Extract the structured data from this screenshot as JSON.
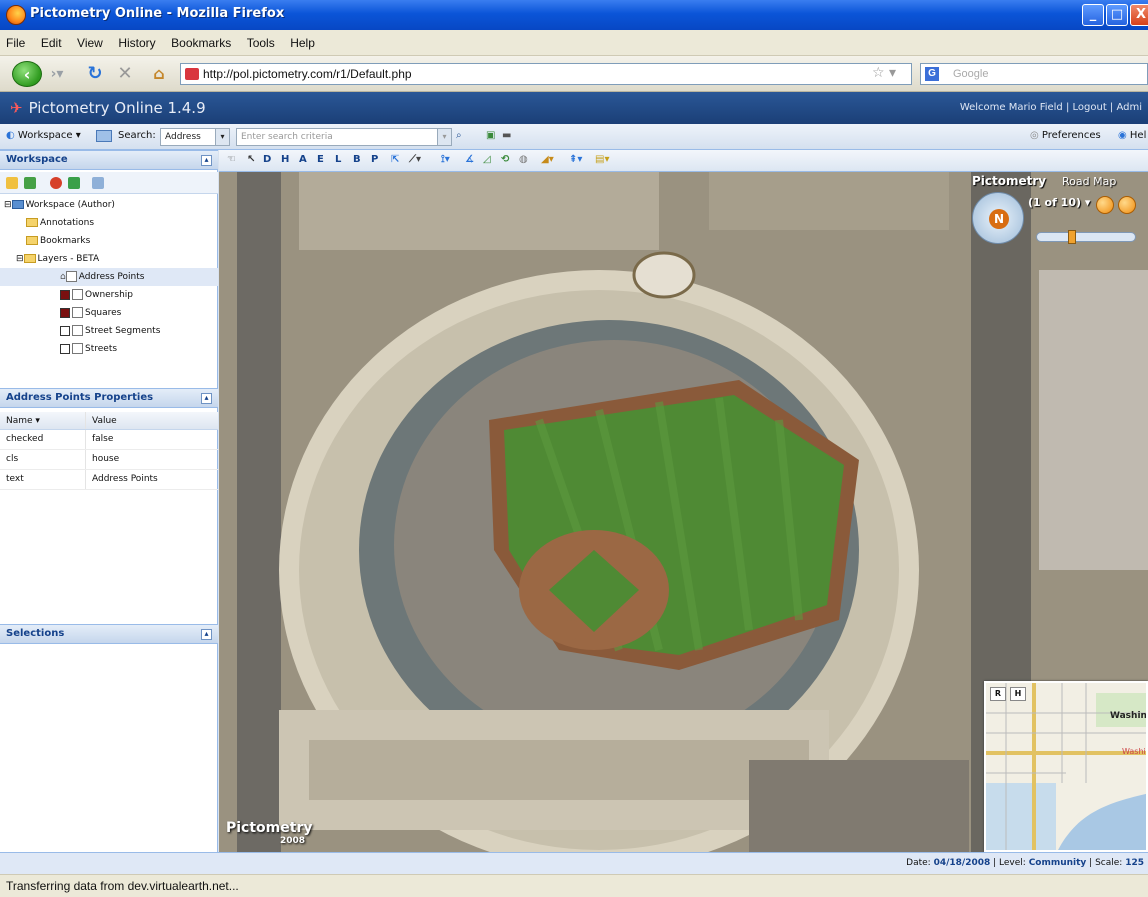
{
  "browser": {
    "title": "Pictometry Online - Mozilla Firefox",
    "menu": [
      "File",
      "Edit",
      "View",
      "History",
      "Bookmarks",
      "Tools",
      "Help"
    ],
    "url": "http://pol.pictometry.com/r1/Default.php",
    "search_placeholder": "Google",
    "status": "Transferring data from dev.virtualearth.net..."
  },
  "app": {
    "title": "Pictometry Online 1.4.9",
    "welcome": "Welcome Mario Field | Logout | Admi"
  },
  "toolbar": {
    "workspace_label": "Workspace",
    "search_label": "Search:",
    "search_type": "Address",
    "search_placeholder": "Enter search criteria",
    "preferences": "Preferences",
    "help": "Hel"
  },
  "workspace": {
    "header": "Workspace",
    "root": "Workspace (Author)",
    "annotations": "Annotations",
    "bookmarks": "Bookmarks",
    "layers": "Layers - BETA",
    "layer_items": [
      {
        "label": "Address Points",
        "color": "#ffffff"
      },
      {
        "label": "Ownership",
        "color": "#7a1010"
      },
      {
        "label": "Squares",
        "color": "#7a1010"
      },
      {
        "label": "Street Segments",
        "color": "#ffffff"
      },
      {
        "label": "Streets",
        "color": "#ffffff"
      }
    ]
  },
  "properties": {
    "header": "Address Points Properties",
    "col_name": "Name",
    "col_value": "Value",
    "rows": [
      {
        "name": "checked",
        "value": "false"
      },
      {
        "name": "cls",
        "value": "house"
      },
      {
        "name": "text",
        "value": "Address Points"
      }
    ]
  },
  "selections": {
    "header": "Selections"
  },
  "map_tools": [
    "D",
    "H",
    "A",
    "E",
    "L",
    "B",
    "P"
  ],
  "map": {
    "brand": "Pictometry",
    "road_map": "Road Map",
    "counter": "(1 of 10)",
    "watermark": "Pictometry",
    "watermark_year": "2008",
    "minimap_tab_r": "R",
    "minimap_tab_h": "H",
    "minimap_city": "Washing",
    "minimap_city2": "Washi",
    "zoom_level": 0.34
  },
  "info": {
    "date_label": "Date:",
    "date": "04/18/2008",
    "level_label": "Level:",
    "level": "Community",
    "scale_label": "Scale:",
    "scale": "125"
  }
}
